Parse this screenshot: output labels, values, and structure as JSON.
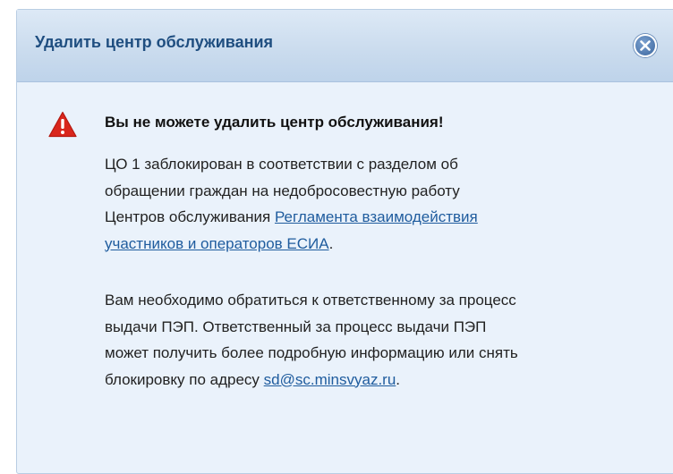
{
  "dialog": {
    "title": "Удалить центр обслуживания",
    "close_icon": "close-circle-icon",
    "warning_icon": "warning-triangle-icon",
    "heading": "Вы не можете удалить центр обслуживания!",
    "paragraph1": {
      "line1": "ЦО 1 заблокирован в соответствии с разделом об",
      "line2": "обращении граждан на недобросовестную работу",
      "line3_text": "Центров обслуживания ",
      "link_part1": "Регламента взаимодействия",
      "link_part2": "участников и операторов ЕСИА",
      "trail": "."
    },
    "paragraph2": {
      "line1": "Вам необходимо обратиться к ответственному за процесс",
      "line2": "выдачи ПЭП. Ответственный за процесс выдачи ПЭП",
      "line3": "может получить более подробную информацию или снять",
      "line4_text": "блокировку по адресу ",
      "email": "sd@sc.minsvyaz.ru",
      "trail": "."
    }
  },
  "colors": {
    "title": "#1f4e80",
    "link": "#1f5c9e",
    "warning": "#d9261c",
    "dialog_bg": "#eaf2fb"
  }
}
